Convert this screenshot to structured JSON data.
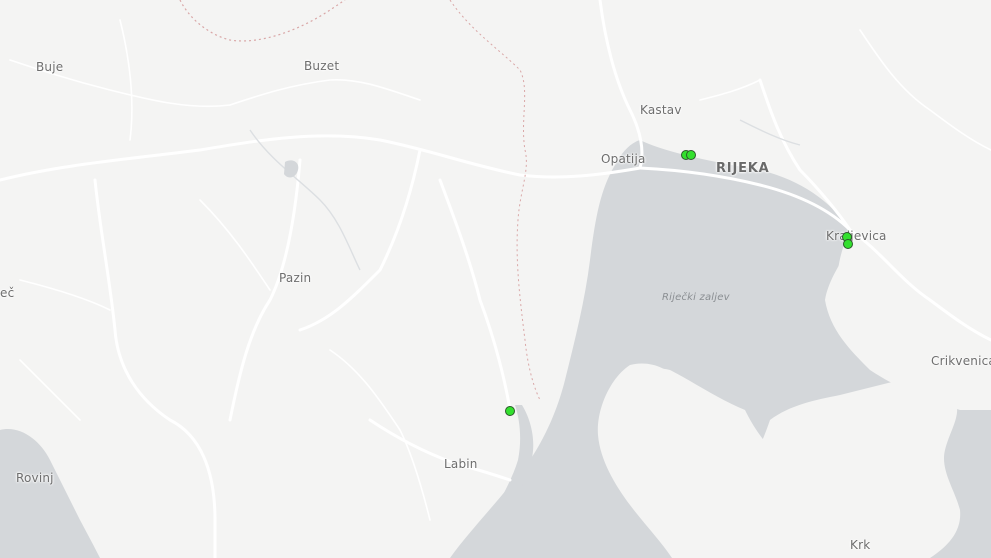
{
  "map": {
    "colors": {
      "land": "#f4f4f3",
      "water": "#d4d7da",
      "road": "#ffffff",
      "border": "#d8a9a9",
      "river": "#e2e4e6",
      "marker_fill": "#33e02e",
      "marker_stroke": "#2b5a2a"
    },
    "places": [
      {
        "id": "buje",
        "name": "Buje"
      },
      {
        "id": "buzet",
        "name": "Buzet"
      },
      {
        "id": "kastav",
        "name": "Kastav"
      },
      {
        "id": "opatija",
        "name": "Opatija"
      },
      {
        "id": "rijeka",
        "name": "RIJEKA"
      },
      {
        "id": "kraljevica",
        "name": "Kraljevica"
      },
      {
        "id": "pazin",
        "name": "Pazin"
      },
      {
        "id": "crikvenica",
        "name": "Crikvenica"
      },
      {
        "id": "labin",
        "name": "Labin"
      },
      {
        "id": "rovinj",
        "name": "Rovinj"
      },
      {
        "id": "krk",
        "name": "Krk"
      },
      {
        "id": "partial-ec",
        "name": "eč"
      }
    ],
    "water_labels": [
      {
        "id": "rijecki-zaljev",
        "name": "Riječki zaljev"
      }
    ],
    "markers": [
      {
        "id": "marker-rijeka-1"
      },
      {
        "id": "marker-rijeka-2"
      },
      {
        "id": "marker-kraljevica-1"
      },
      {
        "id": "marker-kraljevica-2"
      },
      {
        "id": "marker-labin"
      }
    ]
  }
}
